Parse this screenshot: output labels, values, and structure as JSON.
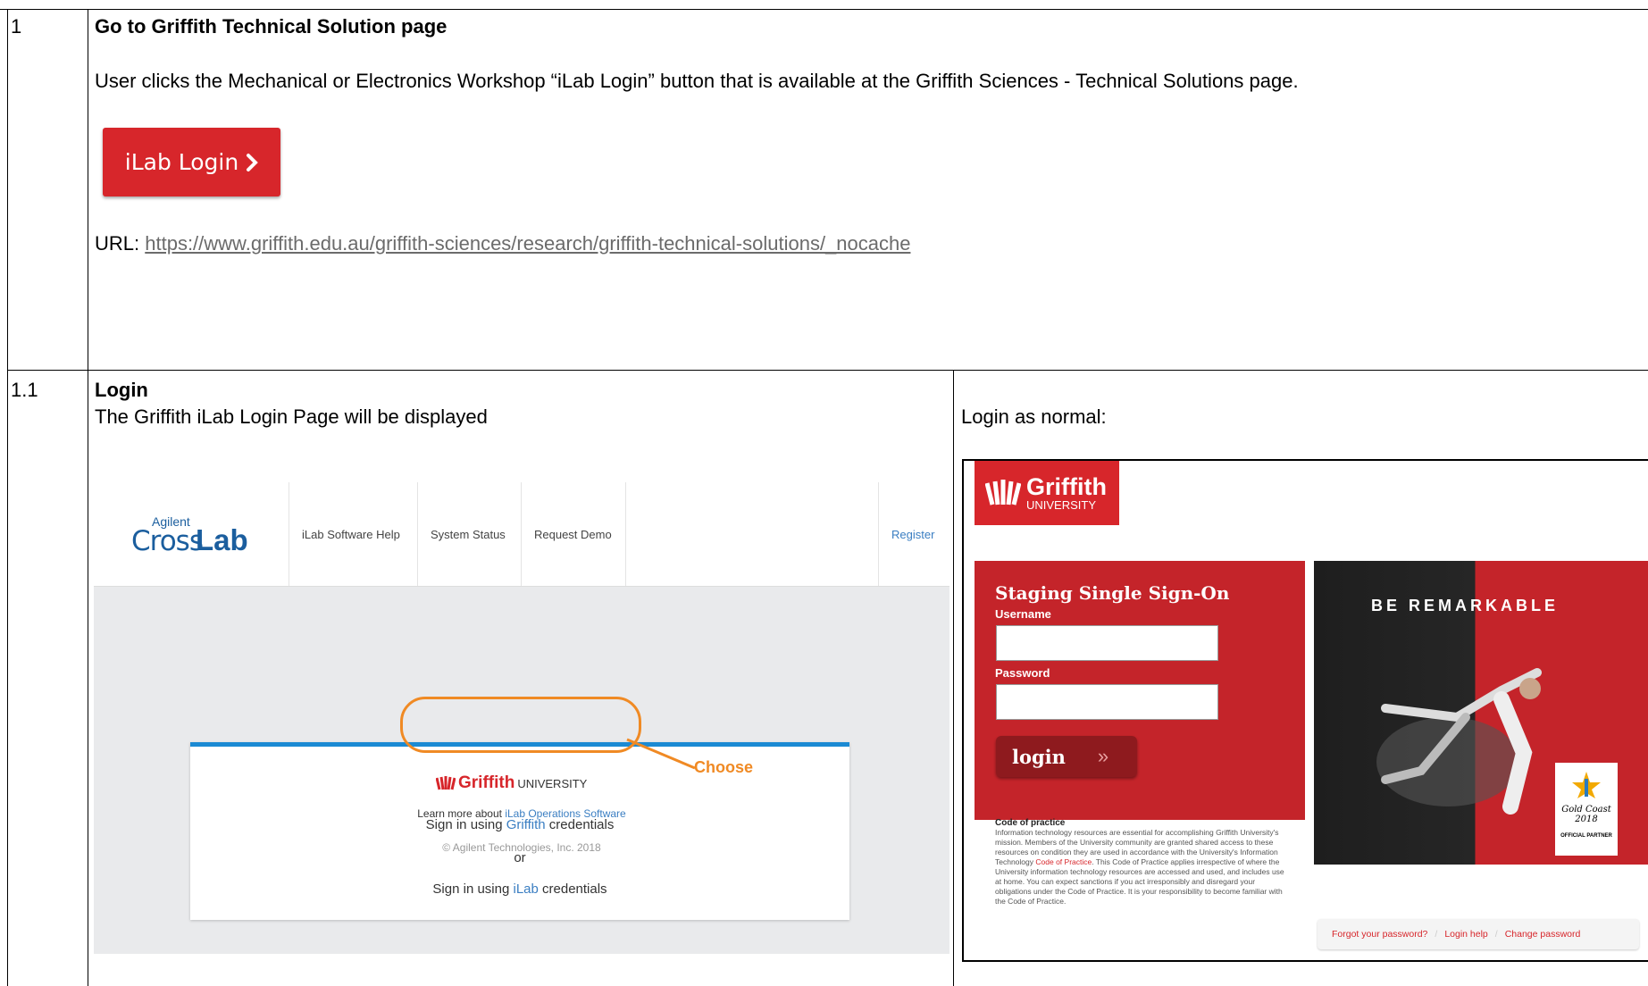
{
  "row1": {
    "num": "1",
    "heading": "Go to Griffith Technical Solution page",
    "text": "User clicks the Mechanical or Electronics Workshop “iLab Login” button that is available at the Griffith Sciences - Technical Solutions page.",
    "button_label": "iLab Login",
    "url_label": "URL: ",
    "url": "https://www.griffith.edu.au/griffith-sciences/research/griffith-technical-solutions/_nocache"
  },
  "row2": {
    "num": "1.1",
    "heading": "Login",
    "text": "The Griffith iLab Login Page will be displayed",
    "right_text": "Login as normal:"
  },
  "crosslab": {
    "logo_small": "Agilent",
    "logo_cross": "Cross",
    "logo_lab": "Lab",
    "nav": [
      "iLab Software Help",
      "System Status",
      "Request Demo"
    ],
    "register": "Register",
    "griffith_brand": "Griffith",
    "griffith_university": "UNIVERSITY",
    "sign_in_prefix": "Sign in using ",
    "sign_in_griffith": "Griffith",
    "sign_in_suffix": " credentials",
    "or": "or",
    "sign_in_ilab": "iLab",
    "choose": "Choose",
    "learn_more": "Learn more about ",
    "learn_more_link": "iLab Operations Software",
    "copyright": "© Agilent Technologies, Inc. 2018"
  },
  "griffith_sso": {
    "logo": "Griffith",
    "logo_sub": "UNIVERSITY",
    "title": "Staging Single Sign-On",
    "username_label": "Username",
    "password_label": "Password",
    "login_button": "login",
    "code_title": "Code of practice",
    "code_text": "Information technology resources are essential for accomplishing Griffith University's mission. Members of the University community are granted shared access to these resources on condition they are used in accordance with the University's Information Technology",
    "code_link": "Code of Practice",
    "code_text2": ". This Code of Practice applies irrespective of where the University information technology resources are accessed and used, and includes use at home. You can expect sanctions if you act irresponsibly and disregard your obligations under the Code of Practice. It is your responsibility to become familiar with the Code of Practice.",
    "be_remarkable": "BE REMARKABLE",
    "badge_line1": "Gold Coast",
    "badge_line2": "2018",
    "official_partner": "OFFICIAL PARTNER",
    "forgot_password": "Forgot your password?",
    "login_help": "Login help",
    "change_password": "Change password"
  }
}
